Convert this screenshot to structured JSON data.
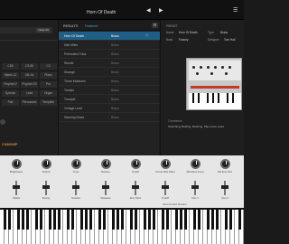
{
  "header": {
    "preset_name": "Horn Of Death",
    "prev_icon": "triangle-left",
    "next_icon": "triangle-right",
    "menu_icon": "menu"
  },
  "filters": {
    "search_button": "Clear All",
    "tags": [
      "CS6",
      "CS-80",
      "C2",
      "Matrix-12",
      "OB-Xa",
      "Piano",
      "Prophet-V",
      "Prophet VS",
      "Pro",
      "Synclav",
      "Lead",
      "Organ",
      "Pad",
      "Percussion",
      "Template"
    ],
    "brand": "CS80/WP"
  },
  "results": {
    "tab_label": "RESULTS",
    "tab_sort": "Featured",
    "rows": [
      {
        "name": "Horn Of Death",
        "category": "Brass",
        "selected": true
      },
      {
        "name": "Mile Miles",
        "category": "Brass"
      },
      {
        "name": "Perforated Tuba",
        "category": "Brass"
      },
      {
        "name": "Slumbi",
        "category": "Brass"
      },
      {
        "name": "Strange",
        "category": "Brass"
      },
      {
        "name": "Three Mobboes",
        "category": "Brass"
      },
      {
        "name": "Tomato",
        "category": "Brass"
      },
      {
        "name": "Trumpet",
        "category": "Brass"
      },
      {
        "name": "Vintage Lead",
        "category": "Brass"
      },
      {
        "name": "Warning Brass",
        "category": "Brass"
      }
    ]
  },
  "preset": {
    "section": "PRESET",
    "name_label": "Name",
    "name_value": "Horn Of Death",
    "type_label": "Type",
    "type_value": "Brass",
    "bank_label": "Bank",
    "bank_value": "Factory",
    "designer_label": "Designer",
    "designer_value": "Tom Hall",
    "comments_label": "Comments",
    "comments_value": "Stretching, Bottling, Meshing. Play some notes"
  },
  "controls": {
    "knobs": [
      "Brightness",
      "Timbre",
      "Time",
      "Detune",
      "Cutoff",
      "Comp Dist Filter",
      "Mod Env Freq",
      "Filt Env Amt"
    ],
    "faders": [
      "Attack",
      "Decay",
      "Sustain",
      "Release",
      "Env Mod",
      "Cutoff",
      "Osc 1",
      "Osc 2"
    ],
    "status": "Sound Hold Sustain"
  }
}
